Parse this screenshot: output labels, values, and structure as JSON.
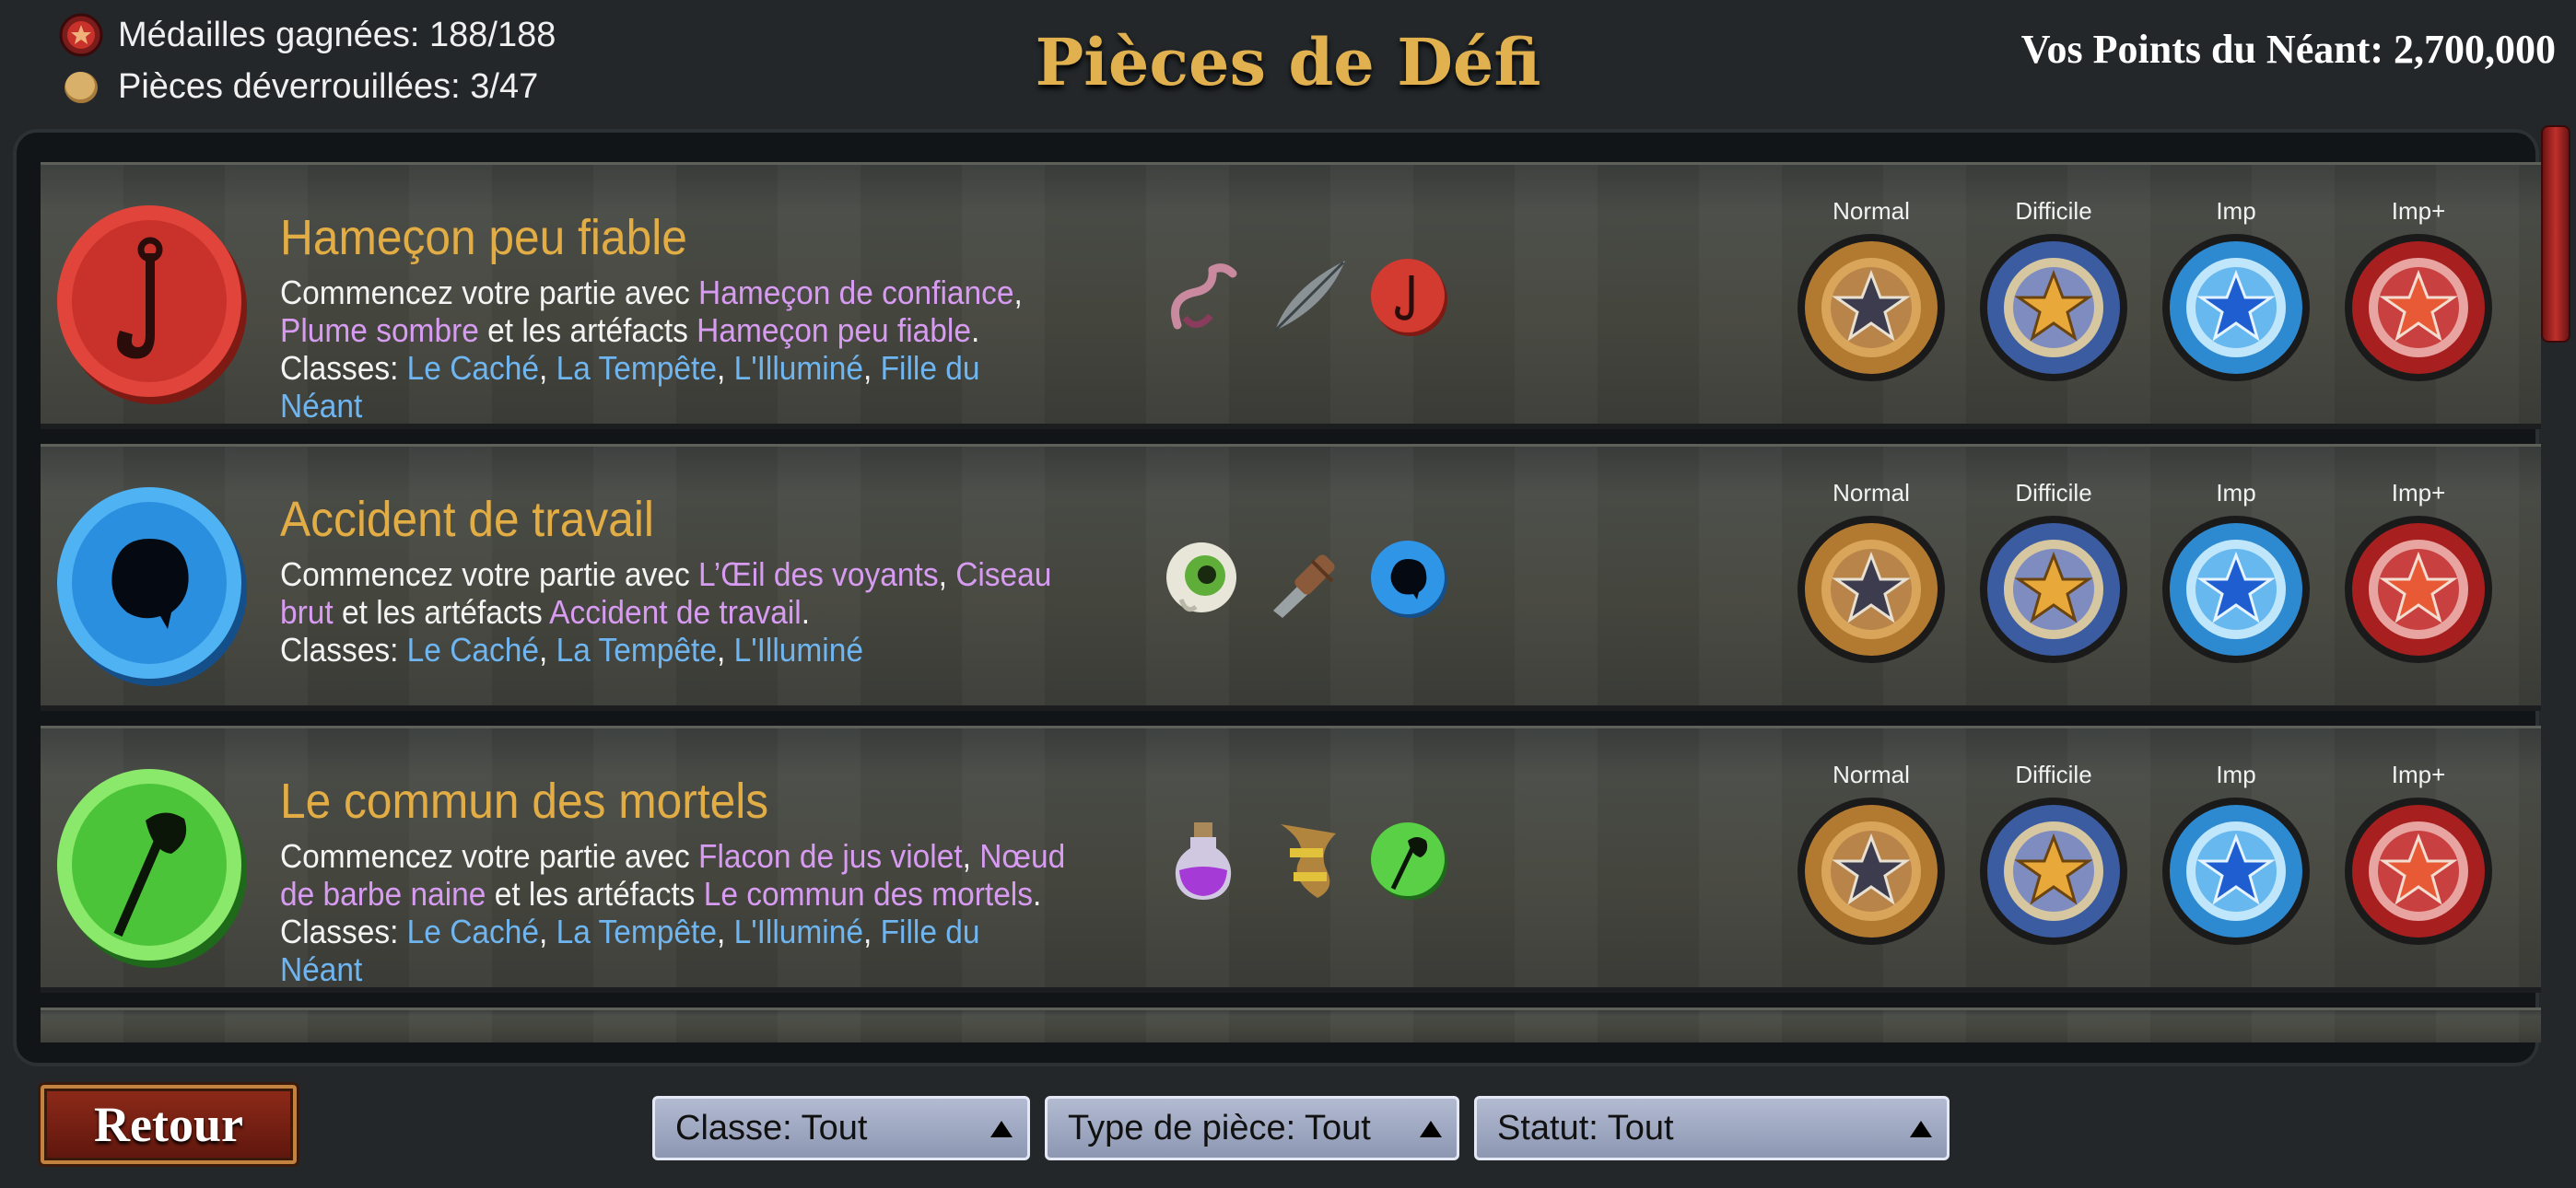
{
  "header": {
    "medals_label": "Médailles gagnées: 188/188",
    "coins_label": "Pièces déverrouillées: 3/47",
    "title": "Pièces de Défi",
    "points_label": "Vos Points du Néant: 2,700,000"
  },
  "medal_labels": [
    "Normal",
    "Difficile",
    "Imp",
    "Imp+"
  ],
  "challenges": [
    {
      "title": "Hameçon peu fiable",
      "desc_intro": "Commencez votre partie avec ",
      "item1": "Hameçon de confiance",
      "sep1": ", ",
      "item2": "Plume sombre",
      "desc_mid": " et les artéfacts ",
      "artifact": "Hameçon peu fiable",
      "desc_end": ".",
      "classes_label": "Classes: ",
      "classes": [
        "Le Caché",
        "La Tempête",
        "L'Illuminé",
        "Fille du Néant"
      ],
      "coin_color": "red",
      "coin_icon": "hook-icon"
    },
    {
      "title": "Accident de travail",
      "desc_intro": "Commencez votre partie avec ",
      "item1": "L’Œil des voyants",
      "sep1": ", ",
      "item2": "Ciseau brut",
      "desc_mid": " et les artéfacts ",
      "artifact": "Accident de travail",
      "desc_end": ".",
      "classes_label": "Classes: ",
      "classes": [
        "Le Caché",
        "La Tempête",
        "L'Illuminé"
      ],
      "coin_color": "blue",
      "coin_icon": "splat-icon"
    },
    {
      "title": "Le commun des mortels",
      "desc_intro": "Commencez votre partie avec ",
      "item1": "Flacon de jus violet",
      "sep1": ", ",
      "item2": "Nœud de barbe naine",
      "desc_mid": " et les artéfacts ",
      "artifact": "Le commun des mortels",
      "desc_end": ".",
      "classes_label": "Classes: ",
      "classes": [
        "Le Caché",
        "La Tempête",
        "L'Illuminé",
        "Fille du Néant"
      ],
      "coin_color": "green",
      "coin_icon": "bindle-icon"
    }
  ],
  "footer": {
    "back_label": "Retour",
    "filter_class": "Classe: Tout",
    "filter_type": "Type de pièce: Tout",
    "filter_status": "Statut: Tout"
  },
  "colors": {
    "title_gold": "#e0b14e",
    "highlight_purple": "#d79cf2",
    "class_blue": "#6fb5f0",
    "coin_red": "#c8322a",
    "coin_blue": "#2b8fe0",
    "coin_green": "#4cc43a"
  }
}
